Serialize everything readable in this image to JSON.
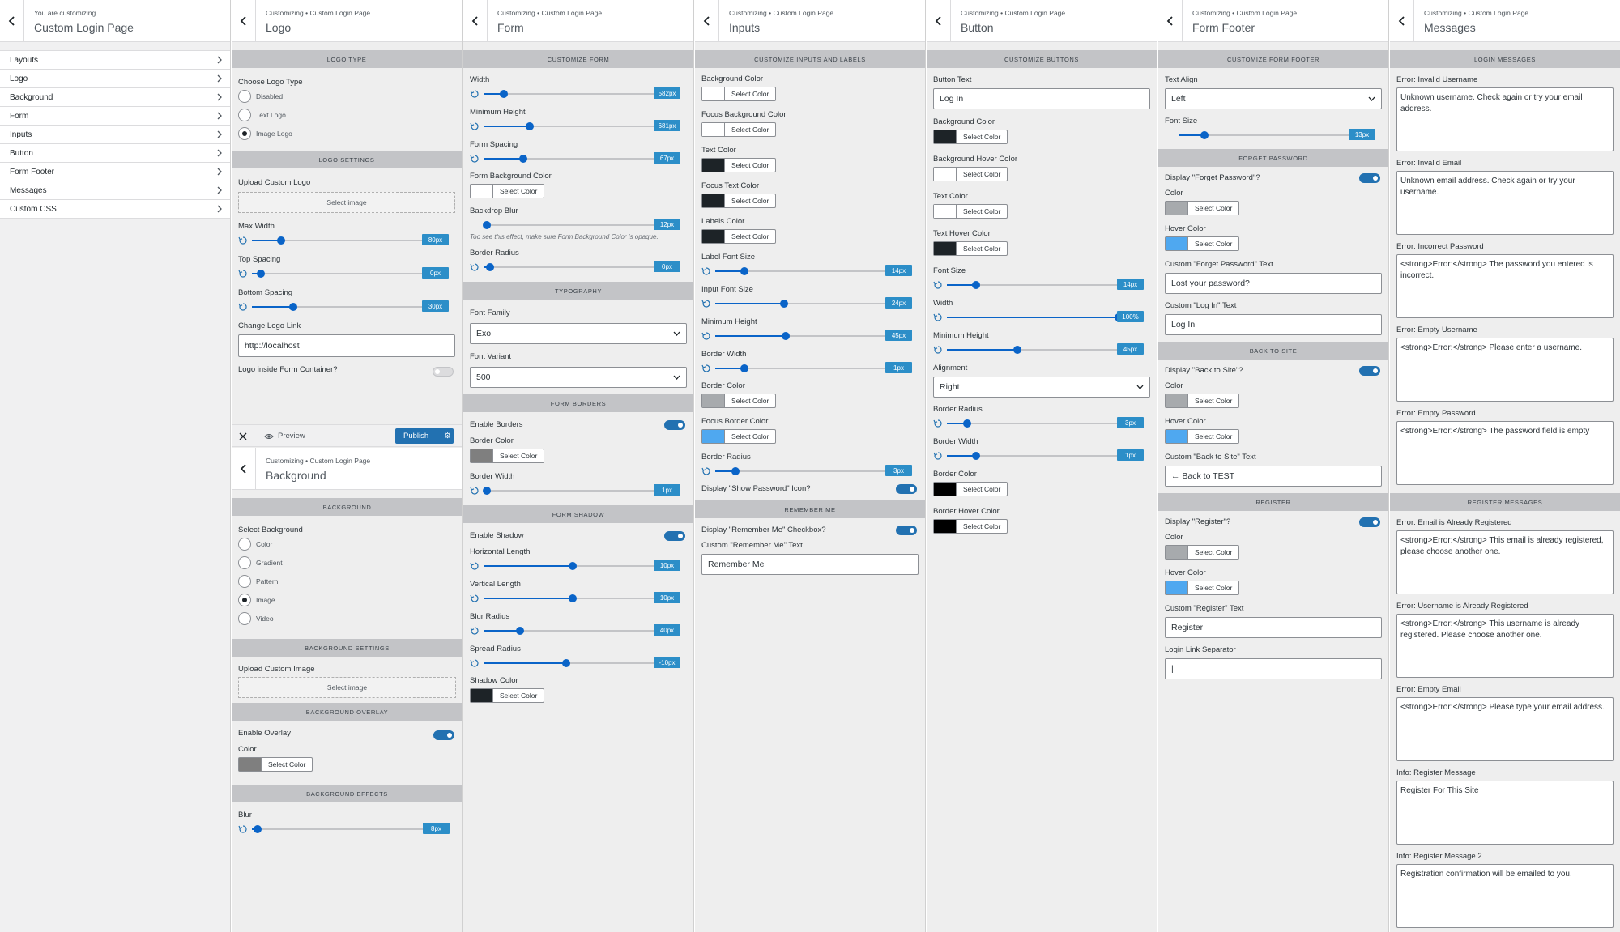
{
  "p1": {
    "crumb": "You are customizing",
    "title": "Custom Login Page",
    "menu": [
      "Layouts",
      "Logo",
      "Background",
      "Form",
      "Inputs",
      "Button",
      "Form Footer",
      "Messages",
      "Custom CSS"
    ]
  },
  "p2": {
    "crumb": "Customizing • Custom Login Page",
    "title": "Logo",
    "s1": "Logo Type",
    "choose_label": "Choose Logo Type",
    "options": [
      "Disabled",
      "Text Logo",
      "Image Logo"
    ],
    "s2": "Logo Settings",
    "upload_label": "Upload Custom Logo",
    "select_image": "Select image",
    "sliders": [
      {
        "label": "Max Width",
        "value": "80px",
        "pct": 0.16
      },
      {
        "label": "Top Spacing",
        "value": "0px",
        "pct": 0.05
      },
      {
        "label": "Bottom Spacing",
        "value": "30px",
        "pct": 0.23
      }
    ],
    "link_label": "Change Logo Link",
    "link_value": "http://localhost",
    "inside_label": "Logo inside Form Container?",
    "footer": {
      "preview": "Preview",
      "publish": "Publish"
    },
    "bg": {
      "crumb": "Customizing • Custom Login Page",
      "title": "Background",
      "s1": "Background",
      "select_label": "Select Background",
      "options": [
        "Color",
        "Gradient",
        "Pattern",
        "Image",
        "Video"
      ],
      "s2": "Background Settings",
      "upload_label": "Upload Custom Image",
      "select_image": "Select image",
      "s3": "Background Overlay",
      "enable_overlay": "Enable Overlay",
      "color_label": "Color",
      "select_color": "Select Color",
      "s4": "Background Effects",
      "blur_label": "Blur",
      "blur_value": "8px",
      "blur_pct": 0.03
    }
  },
  "p3": {
    "crumb": "Customizing • Custom Login Page",
    "title": "Form",
    "s1": "Customize Form",
    "width": {
      "label": "Width",
      "value": "582px",
      "pct": 0.12
    },
    "min_height": {
      "label": "Minimum Height",
      "value": "681px",
      "pct": 0.27
    },
    "spacing": {
      "label": "Form Spacing",
      "value": "67px",
      "pct": 0.23
    },
    "bg_color": "Form Background Color",
    "backdrop": {
      "label": "Backdrop Blur",
      "value": "12px",
      "pct": 0.02
    },
    "backdrop_note": "Too see this effect, make sure Form Background Color is opaque.",
    "radius": {
      "label": "Border Radius",
      "value": "0px",
      "pct": 0.04
    },
    "s2": "Typography",
    "font_family_label": "Font Family",
    "font_family": "Exo",
    "font_variant_label": "Font Variant",
    "font_variant": "500",
    "s3": "Form Borders",
    "enable_borders": "Enable Borders",
    "border_color": "Border Color",
    "border_width": {
      "label": "Border Width",
      "value": "1px",
      "pct": 0.02
    },
    "s4": "Form Shadow",
    "enable_shadow": "Enable Shadow",
    "h_length": {
      "label": "Horizontal Length",
      "value": "10px",
      "pct": 0.52
    },
    "v_length": {
      "label": "Vertical Length",
      "value": "10px",
      "pct": 0.52
    },
    "blur": {
      "label": "Blur Radius",
      "value": "40px",
      "pct": 0.21
    },
    "spread": {
      "label": "Spread Radius",
      "value": "-10px",
      "pct": 0.48
    },
    "shadow_color": "Shadow Color",
    "select_color": "Select Color"
  },
  "p4": {
    "crumb": "Customizing • Custom Login Page",
    "title": "Inputs",
    "s1": "Customize Inputs and Labels",
    "colors": [
      "Background Color",
      "Focus Background Color",
      "Text Color",
      "Focus Text Color",
      "Labels Color"
    ],
    "label_font": {
      "label": "Label Font Size",
      "value": "14px",
      "pct": 0.17
    },
    "input_font": {
      "label": "Input Font Size",
      "value": "24px",
      "pct": 0.4
    },
    "min_height": {
      "label": "Minimum Height",
      "value": "45px",
      "pct": 0.41
    },
    "border_width": {
      "label": "Border Width",
      "value": "1px",
      "pct": 0.17
    },
    "border_color": "Border Color",
    "focus_border_color": "Focus Border Color",
    "border_radius": {
      "label": "Border Radius",
      "value": "3px",
      "pct": 0.12
    },
    "show_password": "Display \"Show Password\" Icon?",
    "s2": "Remember Me",
    "remember_display": "Display \"Remember Me\" Checkbox?",
    "remember_text_label": "Custom \"Remember Me\" Text",
    "remember_text": "Remember Me",
    "select_color": "Select Color"
  },
  "p5": {
    "crumb": "Customizing • Custom Login Page",
    "title": "Button",
    "s1": "Customize Buttons",
    "btn_text_label": "Button Text",
    "btn_text": "Log In",
    "colors": [
      "Background Color",
      "Background Hover Color",
      "Text Color",
      "Text Hover Color"
    ],
    "font_size": {
      "label": "Font Size",
      "value": "14px",
      "pct": 0.17
    },
    "width": {
      "label": "Width",
      "value": "100%",
      "pct": 1.0
    },
    "min_height": {
      "label": "Minimum Height",
      "value": "45px",
      "pct": 0.41
    },
    "alignment_label": "Alignment",
    "alignment": "Right",
    "border_radius": {
      "label": "Border Radius",
      "value": "3px",
      "pct": 0.12
    },
    "border_width": {
      "label": "Border Width",
      "value": "1px",
      "pct": 0.17
    },
    "border_color": "Border Color",
    "border_hover_color": "Border Hover Color",
    "select_color": "Select Color"
  },
  "p6": {
    "crumb": "Customizing • Custom Login Page",
    "title": "Form Footer",
    "s1": "Customize Form Footer",
    "align_label": "Text Align",
    "align": "Left",
    "font_size": {
      "label": "Font Size",
      "value": "13px",
      "pct": 0.15
    },
    "s2": "Forget Password",
    "fp_display": "Display \"Forget Password\"?",
    "color": "Color",
    "hover_color": "Hover Color",
    "fp_text_label": "Custom \"Forget Password\" Text",
    "fp_text": "Lost your password?",
    "login_text_label": "Custom \"Log In\" Text",
    "login_text": "Log In",
    "s3": "Back to Site",
    "bts_display": "Display \"Back to Site\"?",
    "bts_text_label": "Custom \"Back to Site\" Text",
    "bts_text": "← Back to TEST",
    "s4": "Register",
    "reg_display": "Display \"Register\"?",
    "reg_text_label": "Custom \"Register\" Text",
    "reg_text": "Register",
    "sep_label": "Login Link Separator",
    "sep_value": "|",
    "select_color": "Select Color"
  },
  "p7": {
    "crumb": "Customizing • Custom Login Page",
    "title": "Messages",
    "s1": "Login Messages",
    "login": [
      {
        "label": "Error: Invalid Username",
        "text": "Unknown username. Check again or try your email address."
      },
      {
        "label": "Error: Invalid Email",
        "text": "Unknown email address. Check again or try your username."
      },
      {
        "label": "Error: Incorrect Password",
        "text": "<strong>Error:</strong> The password you entered is incorrect."
      },
      {
        "label": "Error: Empty Username",
        "text": "<strong>Error:</strong> Please enter a username."
      },
      {
        "label": "Error: Empty Password",
        "text": "<strong>Error:</strong> The password field is empty"
      }
    ],
    "s2": "Register Messages",
    "register": [
      {
        "label": "Error: Email is Already Registered",
        "text": "<strong>Error:</strong> This email is already registered, please choose another one."
      },
      {
        "label": "Error: Username is Already Registered",
        "text": "<strong>Error:</strong> This username is already registered. Please choose another one."
      },
      {
        "label": "Error: Empty Email",
        "text": "<strong>Error:</strong> Please type your email address."
      },
      {
        "label": "Info: Register Message",
        "text": "Register For This Site"
      },
      {
        "label": "Info: Register Message 2",
        "text": "Registration confirmation will be emailed to you."
      }
    ]
  },
  "colors": {
    "accent": "#0a64c8",
    "badge": "#2c8ec8",
    "primary": "#2271b1",
    "dark": "#1d2327",
    "blue": "#4fa8f0",
    "gray": "#a7aaad",
    "mid": "#7f7f7f",
    "white": "#ffffff"
  }
}
